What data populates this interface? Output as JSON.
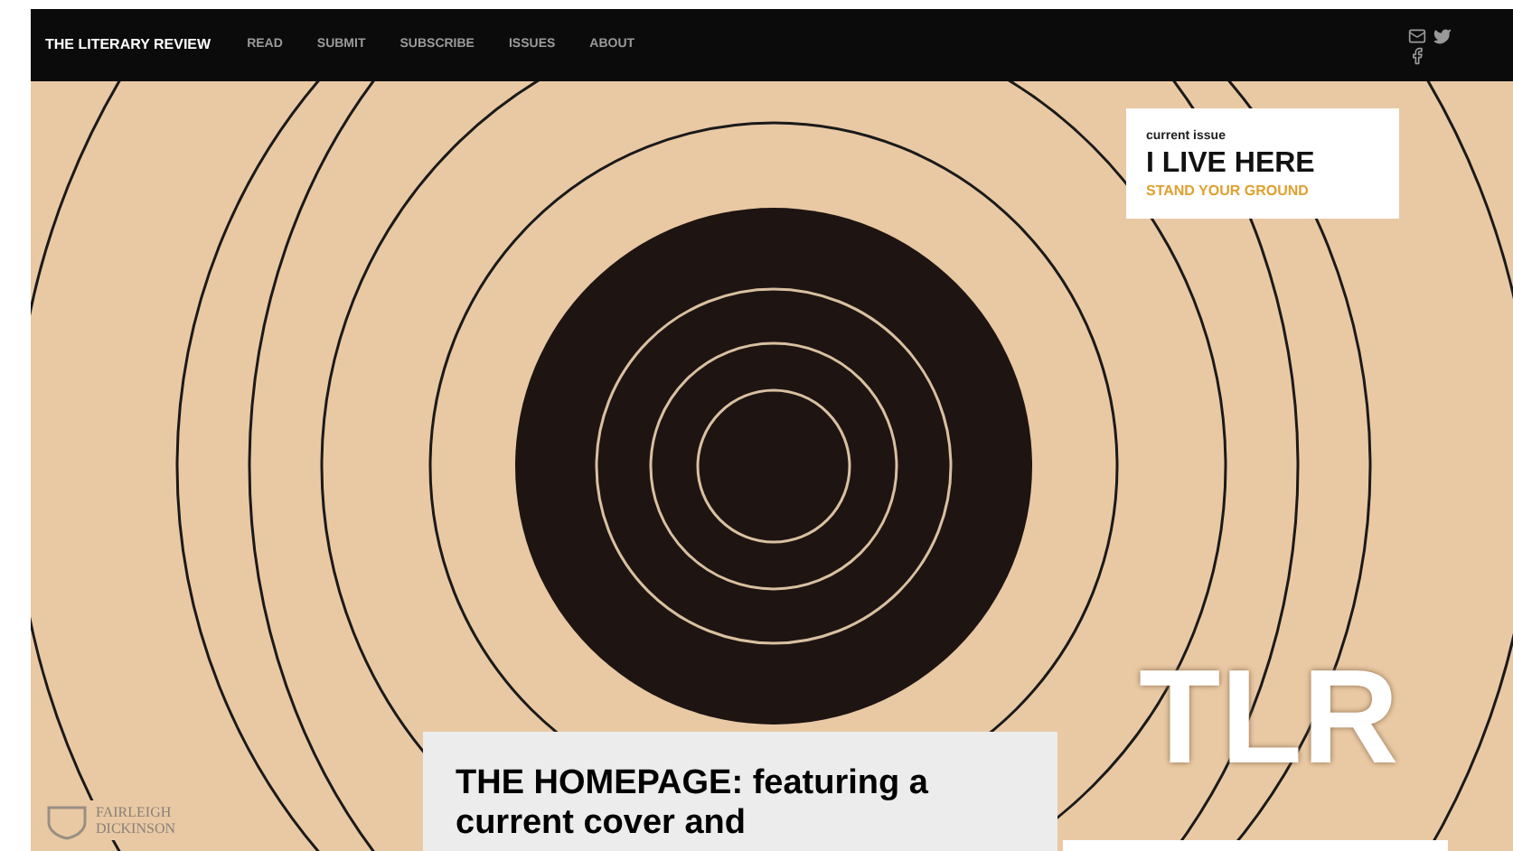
{
  "nav": {
    "brand": "THE LITERARY REVIEW",
    "links": [
      "READ",
      "SUBMIT",
      "SUBSCRIBE",
      "ISSUES",
      "ABOUT"
    ]
  },
  "current_issue": {
    "label": "current issue",
    "title": "I LIVE HERE",
    "subtitle": "STAND YOUR GROUND"
  },
  "hero_logo": "TLR",
  "university": {
    "line_1": "FAIRLEIGH",
    "line_2": "DICKINSON"
  },
  "caption": "THE HOMEPAGE: featuring a current cover and"
}
